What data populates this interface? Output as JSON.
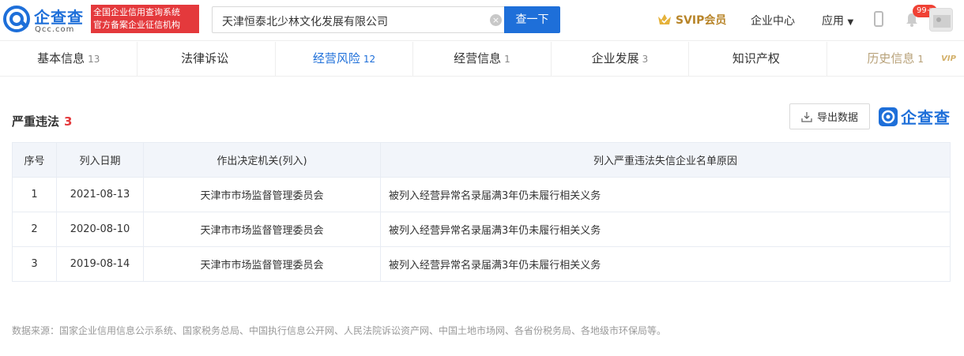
{
  "header": {
    "logo_cn": "企查查",
    "logo_en": "Qcc.com",
    "badge_line1": "全国企业信用查询系统",
    "badge_line2": "官方备案企业征信机构",
    "search_value": "天津恒泰北少林文化发展有限公司",
    "search_button": "查一下",
    "svip_label": "SVIP会员",
    "enterprise_center": "企业中心",
    "apps": "应用",
    "notif_count": "99+",
    "brand_color": "#1e6fd9"
  },
  "tabs": [
    {
      "label": "基本信息",
      "count": "13"
    },
    {
      "label": "法律诉讼",
      "count": ""
    },
    {
      "label": "经营风险",
      "count": "12"
    },
    {
      "label": "经营信息",
      "count": "1"
    },
    {
      "label": "企业发展",
      "count": "3"
    },
    {
      "label": "知识产权",
      "count": ""
    },
    {
      "label": "历史信息",
      "count": "1",
      "tag": "VIP"
    }
  ],
  "section": {
    "title": "严重违法",
    "count": "3",
    "export_label": "导出数据",
    "brand_text": "企查查"
  },
  "table": {
    "headers": [
      "序号",
      "列入日期",
      "作出决定机关(列入)",
      "列入严重违法失信企业名单原因"
    ],
    "rows": [
      [
        "1",
        "2021-08-13",
        "天津市市场监督管理委员会",
        "被列入经营异常名录届满3年仍未履行相关义务"
      ],
      [
        "2",
        "2020-08-10",
        "天津市市场监督管理委员会",
        "被列入经营异常名录届满3年仍未履行相关义务"
      ],
      [
        "3",
        "2019-08-14",
        "天津市市场监督管理委员会",
        "被列入经营异常名录届满3年仍未履行相关义务"
      ]
    ]
  },
  "footer": {
    "source": "数据来源：国家企业信用信息公示系统、国家税务总局、中国执行信息公开网、人民法院诉讼资产网、中国土地市场网、各省份税务局、各地级市环保局等。"
  }
}
